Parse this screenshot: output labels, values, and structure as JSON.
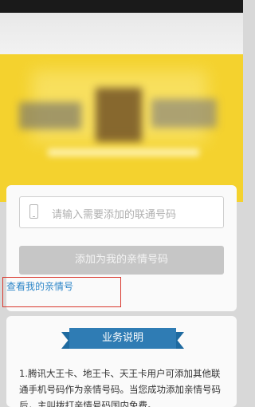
{
  "form": {
    "placeholder": "请输入需要添加的联通号码",
    "add_button_label": "添加为我的亲情号码",
    "view_link_label": "查看我的亲情号"
  },
  "info": {
    "section_title": "业务说明",
    "description": "1.腾讯大王卡、地王卡、天王卡用户可添加其他联通手机号码作为亲情号码。当您成功添加亲情号码后，主叫拨打亲情号码国内免费。"
  },
  "icons": [
    "phone-icon"
  ],
  "colors": {
    "banner": "#f4d22e",
    "link": "#2d86c8",
    "highlight_border": "#d9382e",
    "ribbon": "#2f7cb4",
    "disabled_button": "#c6c6c6"
  }
}
